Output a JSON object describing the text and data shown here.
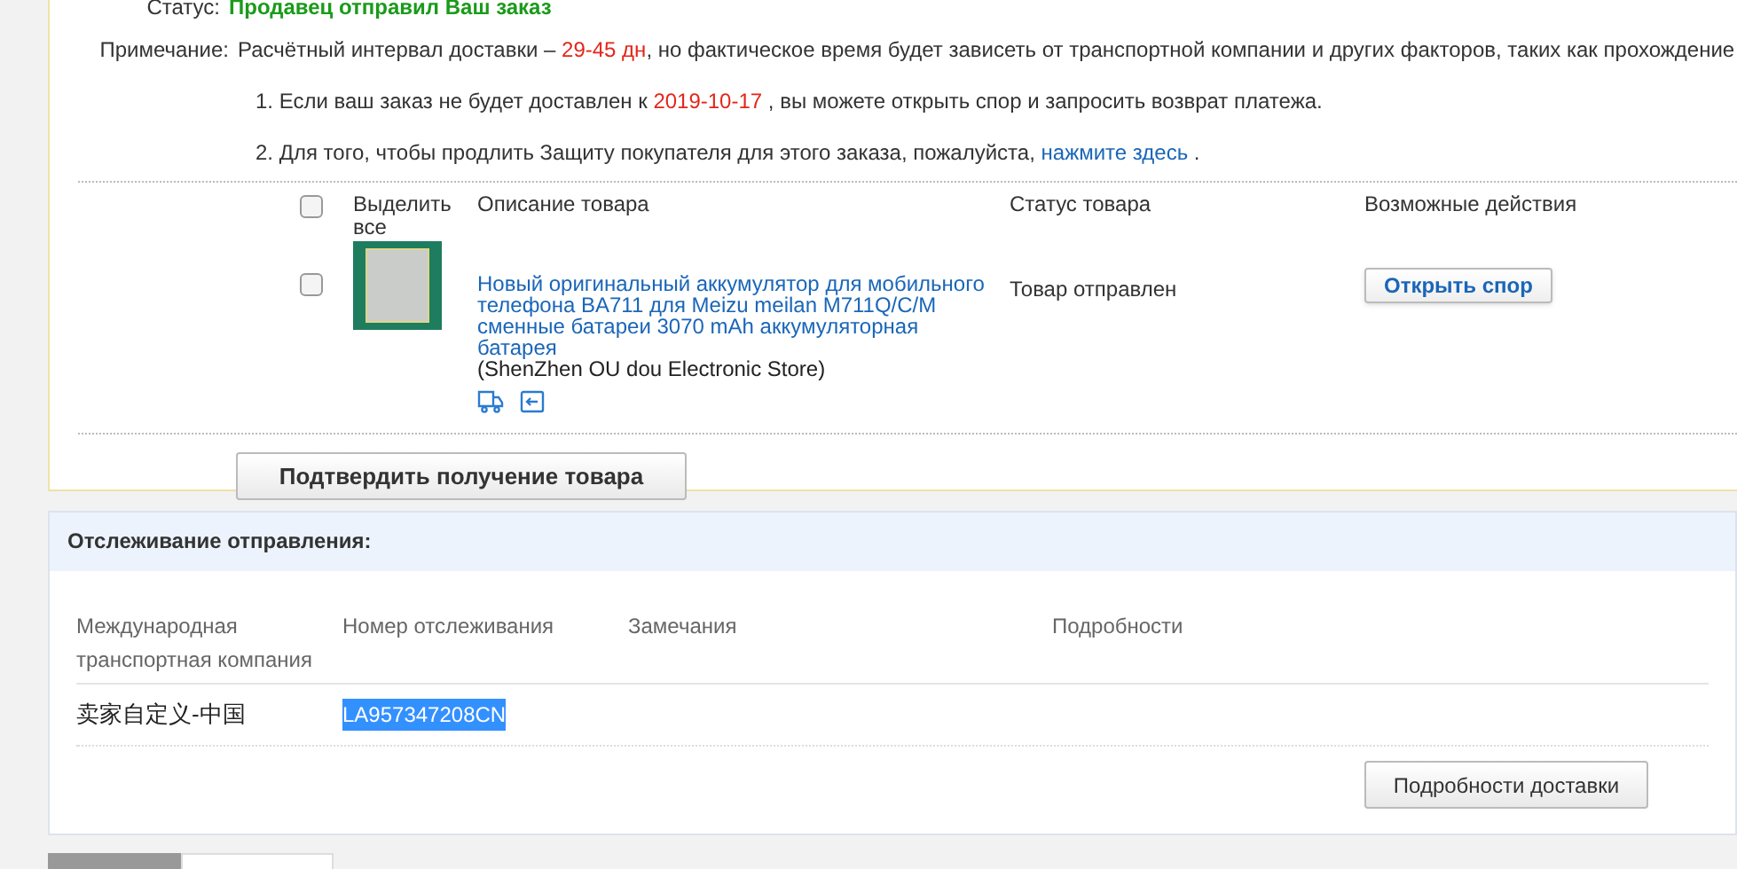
{
  "order": {
    "status": {
      "label": "Статус:",
      "value": "Продавец отправил Ваш заказ"
    },
    "note": {
      "label": "Примечание:",
      "lines": [
        [
          {
            "kind": "plain",
            "text": "Расчётный интервал доставки – "
          },
          {
            "kind": "red",
            "text": "29-45 дн"
          },
          {
            "kind": "plain",
            "text": ", но фактическое время будет зависеть от транспортной компании и других факторов, таких как прохождение"
          }
        ],
        [
          {
            "kind": "plain",
            "text": "1. Если ваш заказ не будет доставлен к "
          },
          {
            "kind": "red",
            "text": "2019-10-17"
          },
          {
            "kind": "plain",
            "text": " , вы можете открыть спор и запросить возврат платежа."
          }
        ],
        [
          {
            "kind": "plain",
            "text": "2. Для того, чтобы продлить Защиту покупателя для этого заказа, пожалуйста, "
          },
          {
            "kind": "link",
            "text": "нажмите здесь"
          },
          {
            "kind": "plain",
            "text": " ."
          }
        ]
      ]
    },
    "columns": {
      "select_all": "Выделить все",
      "select_all_checked": false,
      "description": "Описание товара",
      "status": "Статус товара",
      "actions": "Возможные действия"
    },
    "items": [
      {
        "checked": false,
        "title": "Новый оригинальный аккумулятор для мобильного телефона BA711 для Meizu meilan M711Q/C/M сменные батареи 3070 mAh аккумуляторная батарея",
        "store": "(ShenZhen OU dou Electronic Store)",
        "status": "Товар отправлен",
        "action": "Открыть спор"
      }
    ],
    "confirm_button": "Подтвердить получение товара"
  },
  "tracking": {
    "title": "Отслеживание отправления:",
    "columns": [
      "Международная транспортная компания",
      "Номер отслеживания",
      "Замечания",
      "Подробности"
    ],
    "rows": [
      {
        "company": "卖家自定义-中国",
        "number": "LA957347208CN",
        "number_highlighted": true
      }
    ],
    "button": "Подробности доставки"
  },
  "bottom_tabs": [
    {
      "selected": true
    },
    {
      "selected": false
    }
  ]
}
